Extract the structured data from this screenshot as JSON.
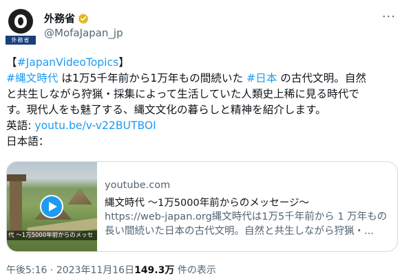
{
  "author": {
    "display_name": "外務省",
    "handle": "@MofaJapan_jp",
    "avatar_tag": "外務省",
    "verified_color": "#e2b719"
  },
  "tweet": {
    "lines": [
      [
        {
          "text": "【",
          "link": false
        },
        {
          "text": "#JapanVideoTopics",
          "link": true
        },
        {
          "text": "】",
          "link": false
        }
      ],
      [
        {
          "text": "#縄文時代",
          "link": true
        },
        {
          "text": " は1万5千年前から1万年もの間続いた ",
          "link": false
        },
        {
          "text": "#日本",
          "link": true
        },
        {
          "text": " の古代文明。自然",
          "link": false
        }
      ],
      [
        {
          "text": "と共生しながら狩猟・採集によって生活していた人類史上稀に見る時代で",
          "link": false
        }
      ],
      [
        {
          "text": "す。現代人をも魅了する、縄文文化の暮らしと精神を紹介します。",
          "link": false
        }
      ],
      [
        {
          "text": "英語: ",
          "link": false
        },
        {
          "text": "youtu.be/v-v22BUTBOI",
          "link": true
        }
      ],
      [
        {
          "text": "日本語：",
          "link": false
        }
      ]
    ]
  },
  "card": {
    "domain": "youtube.com",
    "title": "縄文時代 ～1万5000年前からのメッセージ～",
    "description_lines": [
      "https://web-japan.org縄文時代は1万5千年前から 1 万年もの",
      "長い間続いた日本の古代文明。自然と共生しながら狩猟・..."
    ],
    "thumbnail_caption": "代 ～1万5000年前からのメッセ"
  },
  "meta": {
    "time": "午後5:16",
    "separator": " · ",
    "date": "2023年11月16日",
    "views_count": "149.3万",
    "views_label": " 件の表示"
  },
  "colors": {
    "link": "#1d9bf0",
    "secondary_text": "#536471",
    "primary_text": "#0f1419",
    "card_border": "#cfd9de"
  },
  "icons": {
    "more": "more-icon",
    "verified": "verified-badge-icon",
    "play": "play-icon"
  }
}
